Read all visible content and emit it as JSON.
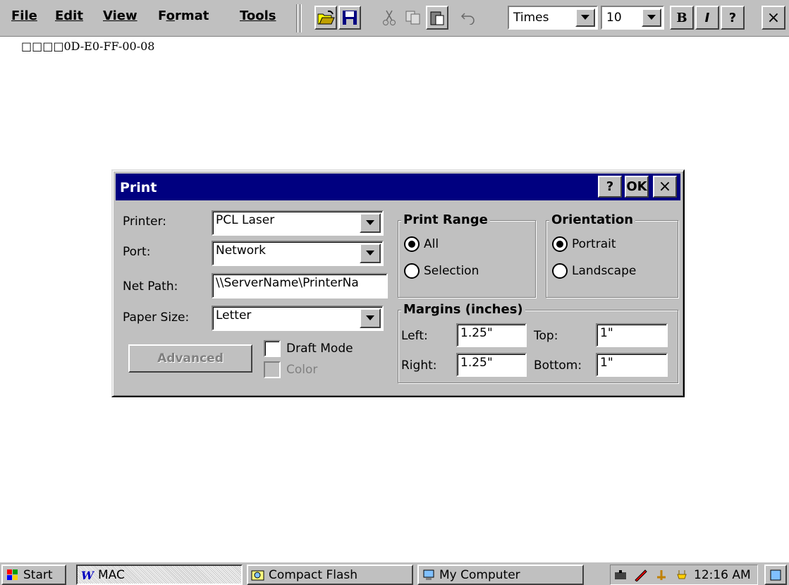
{
  "menu": [
    {
      "label": "File",
      "mnemonic_index": 0
    },
    {
      "label": "Edit",
      "mnemonic_index": 0
    },
    {
      "label": "View",
      "mnemonic_index": 0
    },
    {
      "label": "Format",
      "mnemonic_index": 1
    },
    {
      "label": "Tools",
      "mnemonic_index": 0
    }
  ],
  "toolbar": {
    "icons": [
      "open-folder-icon",
      "save-disk-icon",
      "cut-scissors-icon",
      "copy-icon",
      "paste-icon",
      "undo-icon"
    ],
    "font_name": "Times",
    "font_size": "10",
    "bold_label": "B",
    "italic_label": "I",
    "help_label": "?",
    "close_label": "×"
  },
  "document": {
    "text": "□□□□0D-E0-FF-00-08"
  },
  "dialog": {
    "title": "Print",
    "help_label": "?",
    "ok_label": "OK",
    "close_label": "×",
    "printer_label": "Printer:",
    "printer_value": "PCL Laser",
    "port_label": "Port:",
    "port_value": "Network",
    "netpath_label": "Net Path:",
    "netpath_value": "\\\\ServerName\\PrinterNa",
    "paper_label": "Paper Size:",
    "paper_value": "Letter",
    "advanced_label": "Advanced",
    "draft_label": "Draft Mode",
    "color_label": "Color",
    "print_range": {
      "title": "Print Range",
      "all_label": "All",
      "selection_label": "Selection",
      "selected": "All"
    },
    "orientation": {
      "title": "Orientation",
      "portrait_label": "Portrait",
      "landscape_label": "Landscape",
      "selected": "Portrait"
    },
    "margins": {
      "title": "Margins (inches)",
      "left_label": "Left:",
      "left_value": "1.25\"",
      "right_label": "Right:",
      "right_value": "1.25\"",
      "top_label": "Top:",
      "top_value": "1\"",
      "bottom_label": "Bottom:",
      "bottom_value": "1\""
    }
  },
  "taskbar": {
    "start_label": "Start",
    "tasks": [
      {
        "label": "MAC",
        "icon": "wordpad-icon"
      },
      {
        "label": "Compact Flash",
        "icon": "folder-search-icon"
      },
      {
        "label": "My Computer",
        "icon": "computer-icon"
      }
    ],
    "clock": "12:16 AM"
  },
  "colors": {
    "face": "#c0c0c0",
    "titlebar": "#000080"
  }
}
